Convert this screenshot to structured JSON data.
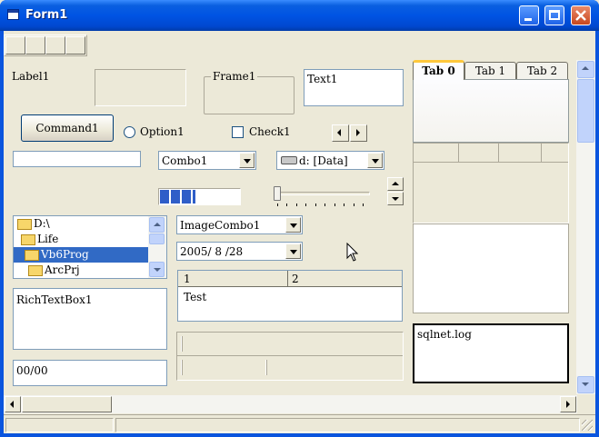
{
  "window": {
    "title": "Form1"
  },
  "label1": "Label1",
  "frame1": "Frame1",
  "text1": "Text1",
  "command1": "Command1",
  "option1": "Option1",
  "check1": "Check1",
  "combo1": "Combo1",
  "drive": "d: [Data]",
  "progress": {
    "value": 0.45
  },
  "tree": {
    "items": [
      "D:\\",
      "Life",
      "Vb6Prog",
      "ArcPrj"
    ],
    "selected": "Vb6Prog"
  },
  "imagecombo": "ImageCombo1",
  "date": "2005/ 8 /28",
  "grid": {
    "headers": [
      "1",
      "2"
    ],
    "cell": "Test"
  },
  "richtext": "RichTextBox1",
  "masked": "00/00",
  "tabs": [
    "Tab 0",
    "Tab 1",
    "Tab 2"
  ],
  "file_list": [
    "sqlnet.log"
  ],
  "icons": {
    "app": "form-icon",
    "drive": "drive-icon",
    "cursor": "arrow-cursor-icon"
  }
}
